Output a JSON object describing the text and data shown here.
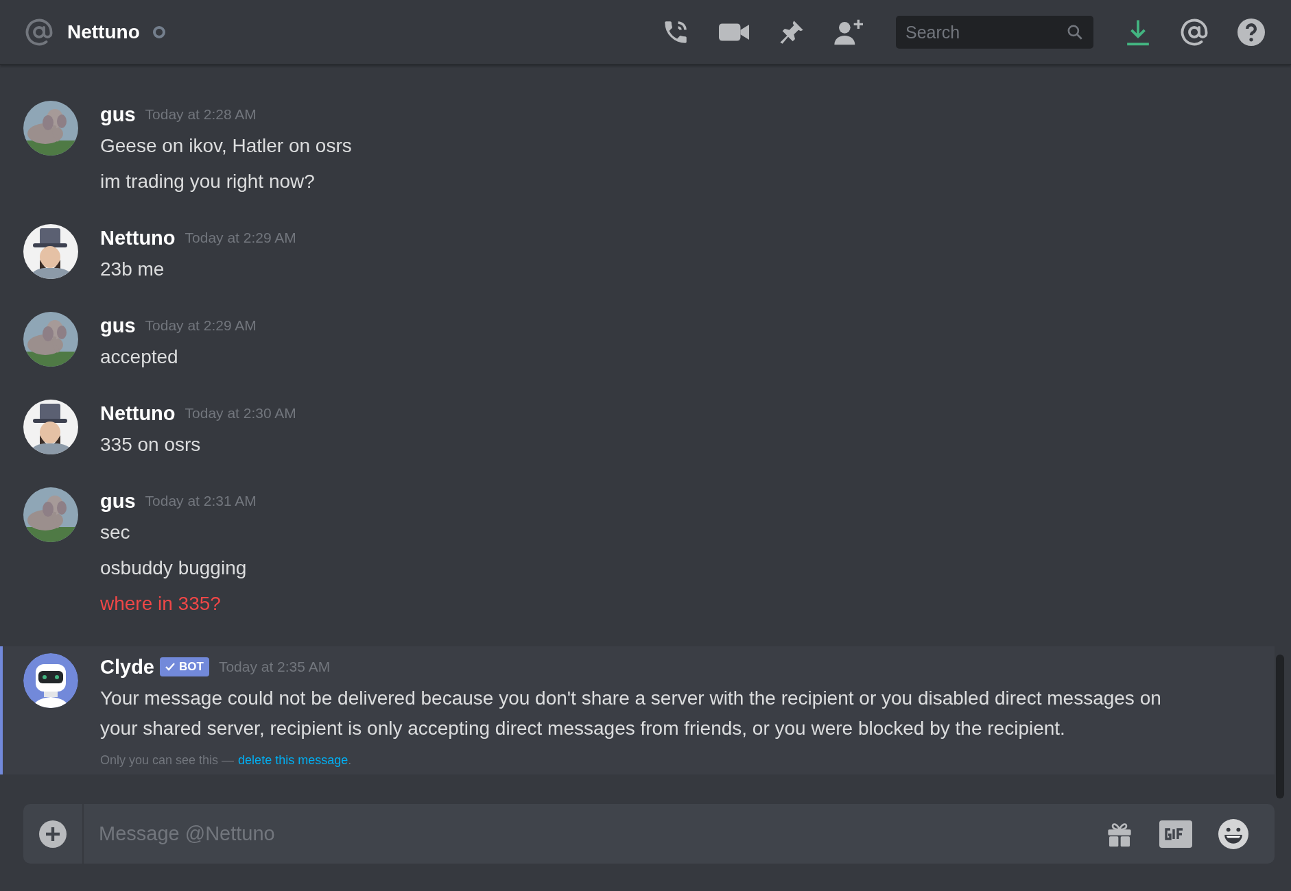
{
  "header": {
    "name": "Nettuno",
    "online": false,
    "search_placeholder": "Search"
  },
  "messages": [
    {
      "author": "gus",
      "kind": "picture",
      "timestamp": "Today at 2:28 AM",
      "lines": [
        {
          "text": "Geese on ikov, Hatler on osrs",
          "failed": false
        },
        {
          "text": "im trading you right now?",
          "failed": false
        }
      ]
    },
    {
      "author": "Nettuno",
      "kind": "silhouette",
      "timestamp": "Today at 2:29 AM",
      "lines": [
        {
          "text": "23b me",
          "failed": false
        }
      ]
    },
    {
      "author": "gus",
      "kind": "picture",
      "timestamp": "Today at 2:29 AM",
      "lines": [
        {
          "text": "accepted",
          "failed": false
        }
      ]
    },
    {
      "author": "Nettuno",
      "kind": "silhouette",
      "timestamp": "Today at 2:30 AM",
      "lines": [
        {
          "text": "335 on osrs",
          "failed": false
        }
      ]
    },
    {
      "author": "gus",
      "kind": "picture",
      "timestamp": "Today at 2:31 AM",
      "lines": [
        {
          "text": "sec",
          "failed": false
        },
        {
          "text": "osbuddy bugging",
          "failed": false
        },
        {
          "text": "where in 335?",
          "failed": true
        }
      ]
    }
  ],
  "bot_message": {
    "author": "Clyde",
    "badge": "BOT",
    "timestamp": "Today at 2:35 AM",
    "highlighted": true,
    "text": "Your message could not be delivered because you don't share a server with the recipient or you disabled direct messages on your shared server, recipient is only accepting direct messages from friends, or you were blocked by the recipient.",
    "note": "Only you can see this —",
    "link": "delete this message",
    "note_end": "."
  },
  "composer": {
    "placeholder": "Message @Nettuno"
  }
}
